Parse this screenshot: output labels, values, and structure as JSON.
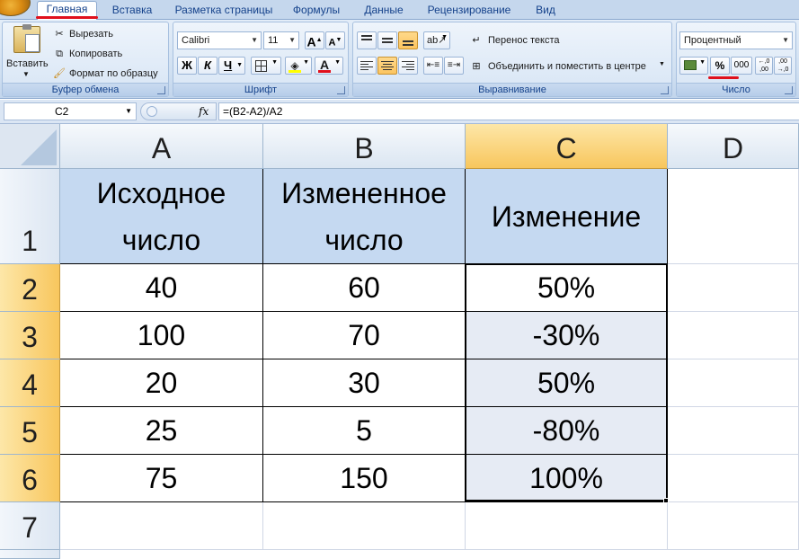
{
  "tabs": [
    "Главная",
    "Вставка",
    "Разметка страницы",
    "Формулы",
    "Данные",
    "Рецензирование",
    "Вид"
  ],
  "clipboard": {
    "paste": "Вставить",
    "cut": "Вырезать",
    "copy": "Копировать",
    "format_painter": "Формат по образцу",
    "label": "Буфер обмена"
  },
  "font": {
    "name": "Calibri",
    "size": "11",
    "grow": "A",
    "shrink": "A",
    "bold": "Ж",
    "italic": "К",
    "underline": "Ч",
    "font_color_letter": "A",
    "label": "Шрифт"
  },
  "alignment": {
    "wrap_text": "Перенос текста",
    "merge_center": "Объединить и поместить в центре",
    "label": "Выравнивание"
  },
  "number": {
    "format": "Процентный",
    "percent": "%",
    "thousands": "000",
    "inc_decimal": "←,0 ,00",
    "dec_decimal": ",00 →,0",
    "label": "Число"
  },
  "formula_bar": {
    "name_box": "C2",
    "fx": "fx",
    "formula": "=(B2-A2)/A2"
  },
  "columns": [
    "A",
    "B",
    "C",
    "D"
  ],
  "rows": [
    "1",
    "2",
    "3",
    "4",
    "5",
    "6",
    "7"
  ],
  "header_row": [
    "Исходное\nчисло",
    "Измененное\nчисло",
    "Изменение"
  ],
  "data_rows": [
    [
      "40",
      "60",
      "50%"
    ],
    [
      "100",
      "70",
      "-30%"
    ],
    [
      "20",
      "30",
      "50%"
    ],
    [
      "25",
      "5",
      "-80%"
    ],
    [
      "75",
      "150",
      "100%"
    ]
  ],
  "colors": {
    "header_fill": "#c5d9f1",
    "selection_fill": "#e6ebf4",
    "selected_heading": "#f8c65d",
    "annotation_red": "#e0101c"
  }
}
